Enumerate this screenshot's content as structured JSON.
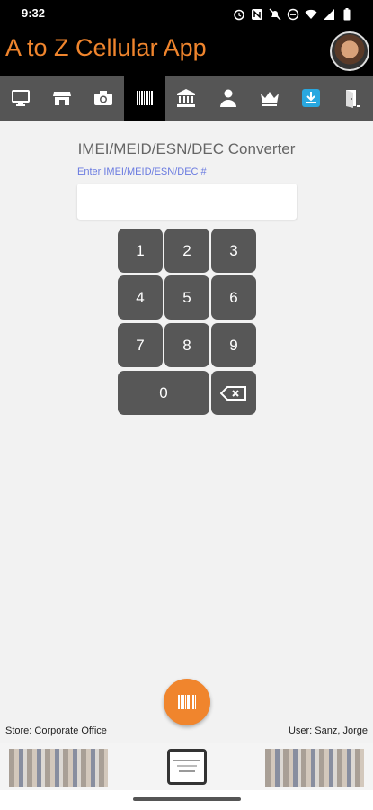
{
  "status_bar": {
    "time": "9:32",
    "icons": [
      "alarm-icon",
      "notification-n-icon",
      "mute-icon",
      "dnd-icon",
      "wifi-icon",
      "signal-icon",
      "battery-icon"
    ]
  },
  "app_bar": {
    "title": "A to Z Cellular App",
    "title_color": "#f0852d",
    "avatar": "user-avatar"
  },
  "tabs": [
    {
      "name": "monitor-icon",
      "active": false
    },
    {
      "name": "store-icon",
      "active": false
    },
    {
      "name": "camera-icon",
      "active": false
    },
    {
      "name": "barcode-icon",
      "active": true
    },
    {
      "name": "bank-icon",
      "active": false
    },
    {
      "name": "person-icon",
      "active": false
    },
    {
      "name": "crown-icon",
      "active": false
    },
    {
      "name": "download-icon",
      "active": false
    },
    {
      "name": "exit-door-icon",
      "active": false
    }
  ],
  "converter": {
    "title": "IMEI/MEID/ESN/DEC Converter",
    "input_label": "Enter IMEI/MEID/ESN/DEC #",
    "input_value": ""
  },
  "keypad": {
    "keys": [
      "1",
      "2",
      "3",
      "4",
      "5",
      "6",
      "7",
      "8",
      "9",
      "0"
    ],
    "backspace": "backspace-icon"
  },
  "fab": {
    "icon": "barcode-icon",
    "color": "#f0852d"
  },
  "footer": {
    "store": "Store: Corporate Office",
    "user": "User: Sanz, Jorge"
  },
  "banner": {
    "logo": "company-logo"
  }
}
